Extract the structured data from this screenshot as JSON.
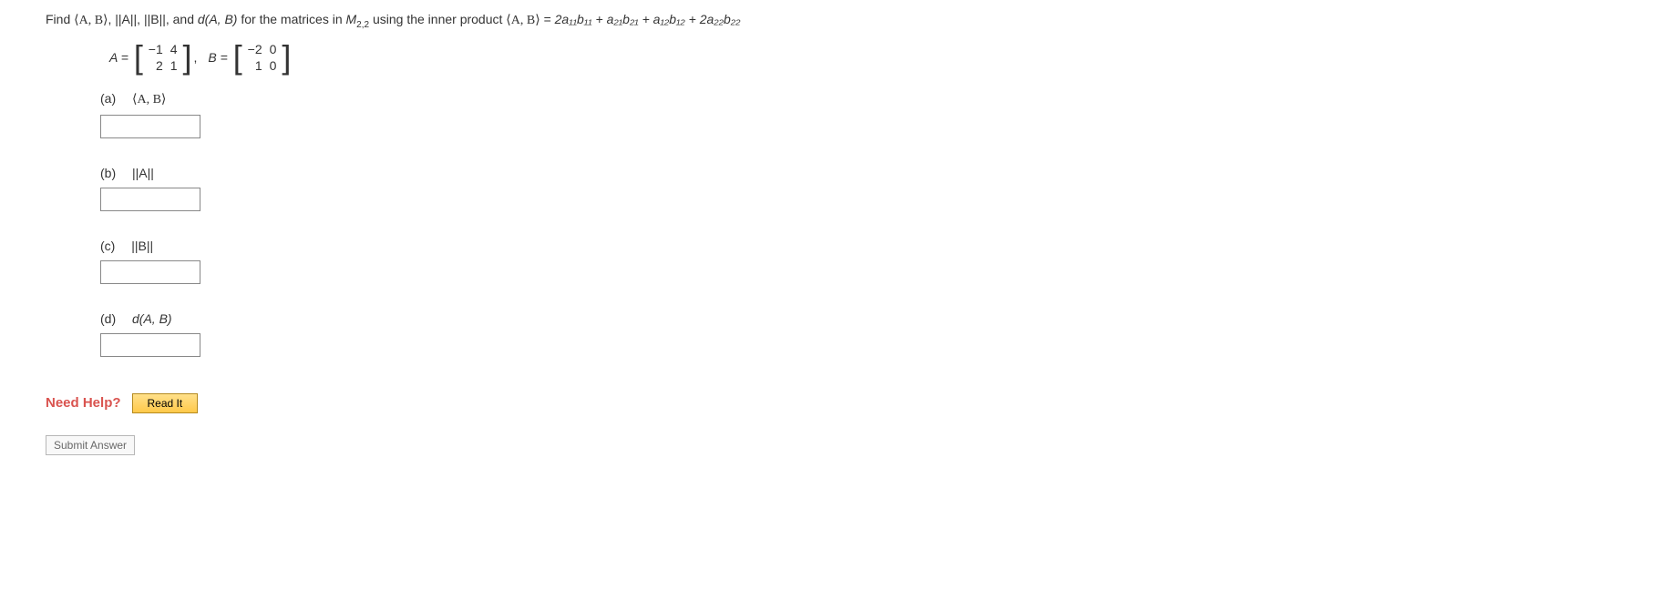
{
  "question": {
    "prefix": "Find ",
    "item1": "⟨A, B⟩",
    "sep1": ", ",
    "item2": "||A||",
    "sep2": ", ",
    "item3": "||B||",
    "sep3": ", and ",
    "item4": "d(A, B)",
    "mid": " for the matrices in ",
    "space": "M",
    "space_sub": "2,2",
    "mid2": " using the inner product ",
    "ip_lhs": "⟨A, B⟩",
    "eq": " = ",
    "rhs": "2a₁₁b₁₁ + a₂₁b₂₁ + a₁₂b₁₂ + 2a₂₂b₂₂"
  },
  "matrices": {
    "A_label": "A =",
    "A": {
      "r1c1": "−1",
      "r1c2": "4",
      "r2c1": "2",
      "r2c2": "1"
    },
    "comma": ",",
    "B_label": "B =",
    "B": {
      "r1c1": "−2",
      "r1c2": "0",
      "r2c1": "1",
      "r2c2": "0"
    }
  },
  "parts": {
    "a": {
      "letter": "(a)",
      "label": "⟨A, B⟩"
    },
    "b": {
      "letter": "(b)",
      "label": "||A||"
    },
    "c": {
      "letter": "(c)",
      "label": "||B||"
    },
    "d": {
      "letter": "(d)",
      "label": "d(A, B)"
    }
  },
  "help": {
    "label": "Need Help?",
    "read_it": "Read It"
  },
  "submit": {
    "label": "Submit Answer"
  }
}
